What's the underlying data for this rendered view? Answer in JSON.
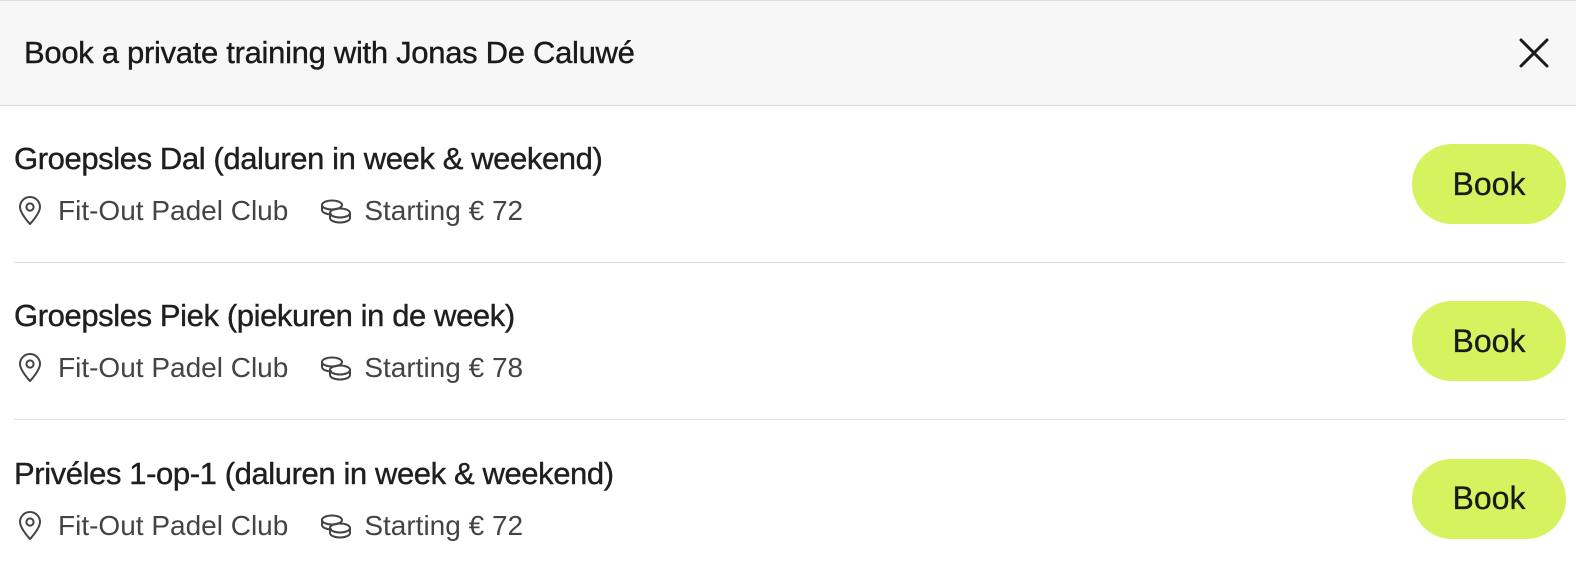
{
  "modal": {
    "title": "Book a private training with Jonas De Caluwé"
  },
  "lessons": [
    {
      "title": "Groepsles Dal (daluren in week & weekend)",
      "location": "Fit-Out Padel Club",
      "price": "Starting € 72",
      "button_label": "Book"
    },
    {
      "title": "Groepsles Piek (piekuren in de week)",
      "location": "Fit-Out Padel Club",
      "price": "Starting € 78",
      "button_label": "Book"
    },
    {
      "title": "Privéles 1-op-1 (daluren in week & weekend)",
      "location": "Fit-Out Padel Club",
      "price": "Starting € 72",
      "button_label": "Book"
    }
  ],
  "icons": {
    "close": "close-icon",
    "location": "map-pin-icon",
    "price": "coins-icon"
  },
  "colors": {
    "book_button": "#d6f25e",
    "header_bg": "#f7f7f7"
  }
}
